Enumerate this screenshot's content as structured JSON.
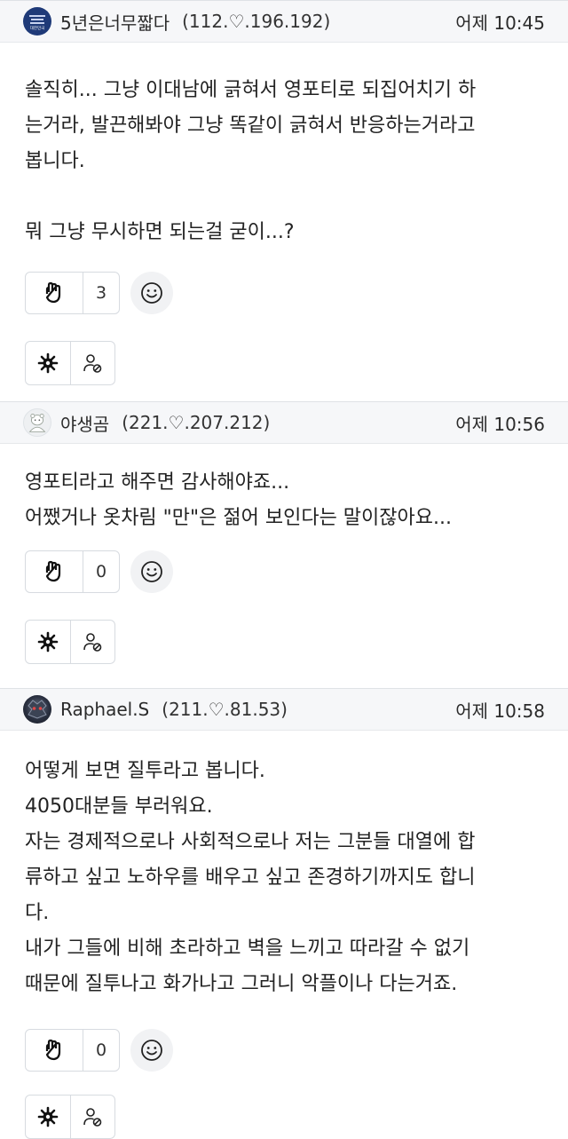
{
  "comments": [
    {
      "nickname": "5년은너무짧다",
      "ip": "(112.♡.196.192)",
      "time": "어제 10:45",
      "avatar_label": "대한민국",
      "lines": [
        "솔직히... 그냥 이대남에 긁혀서 영포티로 되집어치기 하",
        "는거라, 발끈해봐야 그냥 똑같이 긁혀서 반응하는거라고",
        "봅니다.",
        "",
        "뭐 그냥 무시하면 되는걸 굳이...?"
      ],
      "like_count": "3"
    },
    {
      "nickname": "야생곰",
      "ip": "(221.♡.207.212)",
      "time": "어제 10:56",
      "lines": [
        "영포티라고 해주면 감사해야죠...",
        "어쨌거나 옷차림 \"만\"은 젊어 보인다는 말이잖아요..."
      ],
      "like_count": "0"
    },
    {
      "nickname": "Raphael.S",
      "ip": "(211.♡.81.53)",
      "time": "어제 10:58",
      "lines": [
        "어떻게 보면 질투라고 봅니다.",
        "4050대분들 부러워요.",
        "자는 경제적으로나 사회적으로나 저는 그분들 대열에 합",
        "류하고 싶고 노하우를 배우고 싶고 존경하기까지도 합니",
        "다.",
        "내가 그들에 비해 초라하고 벽을 느끼고 따라갈 수 없기",
        "때문에 질투나고 화가나고 그러니 악플이나 다는거죠."
      ],
      "like_count": "0"
    }
  ],
  "icons": {
    "like": "like-hand-icon",
    "smile": "smile-face-icon",
    "settings": "gear-icon",
    "user": "user-block-icon"
  },
  "colors": {
    "header_bg": "#f6f7f9",
    "border": "#d7dbe0",
    "text": "#222222"
  }
}
